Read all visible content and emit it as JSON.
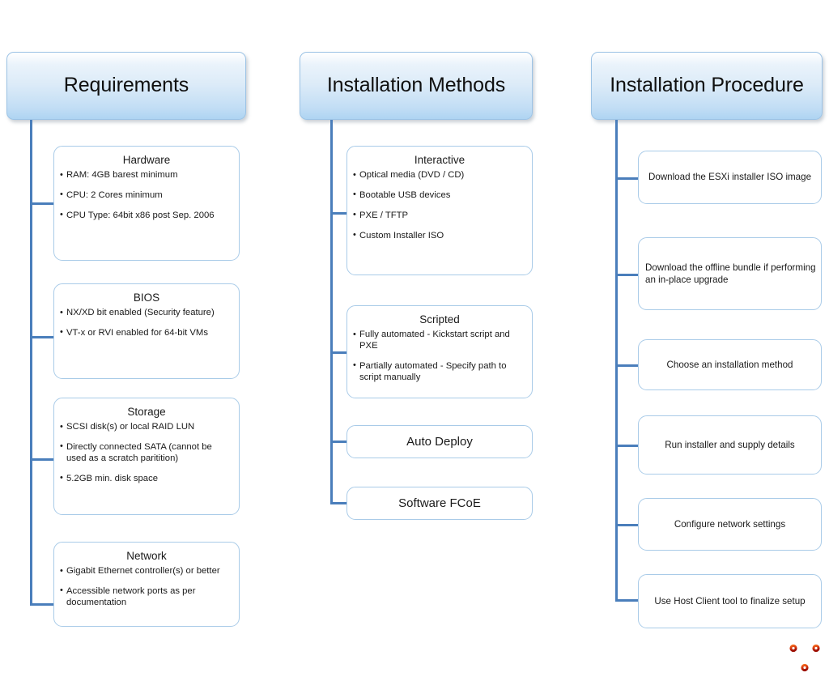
{
  "diagram": {
    "columns": [
      {
        "id": "requirements",
        "header": "Requirements",
        "nodes": [
          {
            "title": "Hardware",
            "bullets": [
              "RAM: 4GB barest minimum",
              "CPU: 2 Cores minimum",
              "CPU Type:  64bit x86 post Sep. 2006"
            ]
          },
          {
            "title": "BIOS",
            "bullets": [
              "NX/XD bit enabled (Security feature)",
              "VT-x or RVI enabled for 64-bit VMs"
            ]
          },
          {
            "title": "Storage",
            "bullets": [
              "SCSI disk(s) or local RAID LUN",
              "Directly connected SATA (cannot be used as a scratch paritition)",
              "5.2GB min. disk space"
            ]
          },
          {
            "title": "Network",
            "bullets": [
              "Gigabit Ethernet controller(s) or better",
              "Accessible network ports as per documentation"
            ]
          }
        ]
      },
      {
        "id": "installation-methods",
        "header": "Installation Methods",
        "nodes": [
          {
            "title": "Interactive",
            "bullets": [
              "Optical media (DVD / CD)",
              "Bootable USB devices",
              "PXE / TFTP",
              "Custom Installer ISO"
            ]
          },
          {
            "title": "Scripted",
            "bullets": [
              "Fully automated - Kickstart script and PXE",
              "Partially automated - Specify path to script manually"
            ]
          },
          {
            "title": "Auto Deploy",
            "bullets": []
          },
          {
            "title": "Software FCoE",
            "bullets": []
          }
        ]
      },
      {
        "id": "installation-procedure",
        "header": "Installation Procedure",
        "steps": [
          "Download the ESXi installer ISO image",
          "Download the offline bundle if performing an in-place upgrade",
          "Choose an installation method",
          "Run installer and supply details",
          "Configure network settings",
          "Use Host Client tool to finalize setup"
        ]
      }
    ]
  },
  "branding": {
    "logo_name": "branching-network-logo",
    "logo_colors": [
      "#e8541f",
      "#b01505"
    ]
  },
  "theme": {
    "connector_color": "#4a7ebb",
    "box_border": "#a9cbe8",
    "header_border": "#9cc3e5",
    "header_gradient_top": "#ffffff",
    "header_gradient_bottom": "#aed4f2",
    "background": "#ffffff"
  }
}
